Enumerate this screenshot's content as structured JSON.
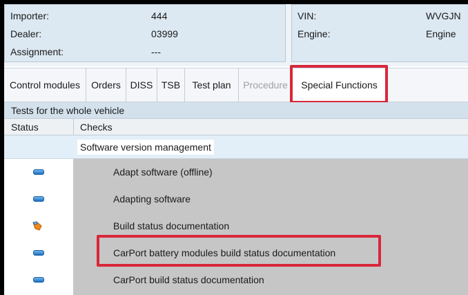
{
  "header": {
    "left": [
      {
        "label": "Importer:",
        "value": "444"
      },
      {
        "label": "Dealer:",
        "value": "03999"
      },
      {
        "label": "Assignment:",
        "value": "---"
      }
    ],
    "right": [
      {
        "label": "VIN:",
        "value": "WVGJN"
      },
      {
        "label": "Engine:",
        "value": "Engine"
      }
    ]
  },
  "tabs": [
    {
      "label": "Control modules",
      "state": "normal"
    },
    {
      "label": "Orders",
      "state": "normal"
    },
    {
      "label": "DISS",
      "state": "normal"
    },
    {
      "label": "TSB",
      "state": "normal"
    },
    {
      "label": "Test plan",
      "state": "normal"
    },
    {
      "label": "Procedure",
      "state": "disabled"
    },
    {
      "label": "Special Functions",
      "state": "active"
    }
  ],
  "section_title": "Tests for the whole vehicle",
  "columns": {
    "status": "Status",
    "checks": "Checks"
  },
  "group_label": "Software version management",
  "rows": [
    {
      "label": "Adapt software (offline)",
      "status_icon": "blue-dash-icon"
    },
    {
      "label": "Adapting software",
      "status_icon": "blue-dash-icon"
    },
    {
      "label": "Build status documentation",
      "status_icon": "orange-hand-icon"
    },
    {
      "label": "CarPort battery modules build status documentation",
      "status_icon": "blue-dash-icon"
    },
    {
      "label": "CarPort build status documentation",
      "status_icon": "blue-dash-icon"
    }
  ],
  "colors": {
    "highlight": "#d9273a",
    "status_blue": "#1f6fbf",
    "status_orange": "#f08a1a"
  }
}
